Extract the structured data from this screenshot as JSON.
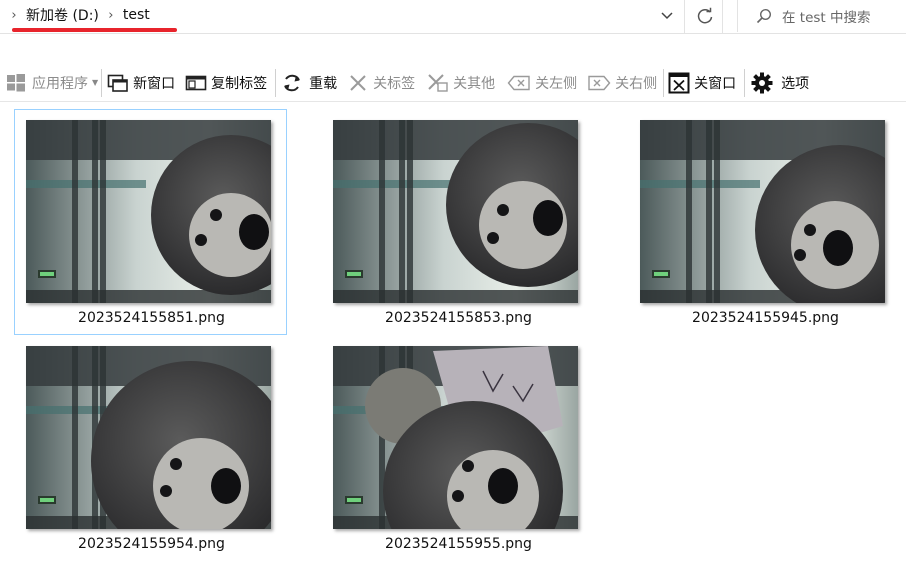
{
  "breadcrumb": {
    "items": [
      "新加卷 (D:)",
      "test"
    ]
  },
  "search": {
    "placeholder": "在 test 中搜索"
  },
  "toolbar": {
    "app_programs": "应用程序",
    "new_window": "新窗口",
    "copy_tab": "复制标签",
    "reload": "重载",
    "close_tab": "关标签",
    "close_others": "关其他",
    "close_left": "关左侧",
    "close_right": "关右侧",
    "close_window": "关窗口",
    "options": "选项"
  },
  "files": [
    {
      "name": "2023524155851.png",
      "selected": true,
      "variant": "a"
    },
    {
      "name": "2023524155853.png",
      "selected": false,
      "variant": "b"
    },
    {
      "name": "2023524155945.png",
      "selected": false,
      "variant": "c"
    },
    {
      "name": "2023524155954.png",
      "selected": false,
      "variant": "d"
    },
    {
      "name": "2023524155955.png",
      "selected": false,
      "variant": "e"
    }
  ],
  "colors": {
    "accent_underline": "#e8242c",
    "selection_border": "#99d1ff"
  }
}
